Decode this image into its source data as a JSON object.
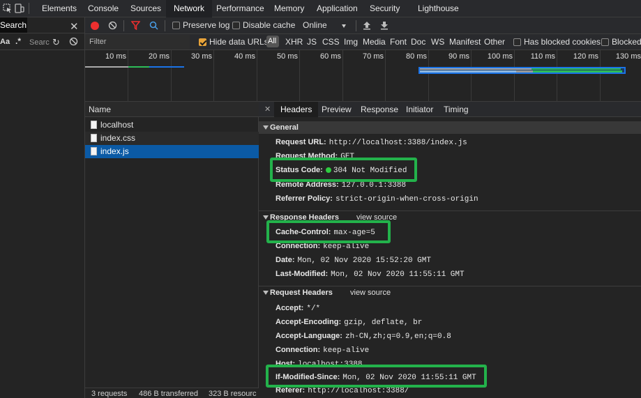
{
  "tabs": [
    "Elements",
    "Console",
    "Sources",
    "Network",
    "Performance",
    "Memory",
    "Application",
    "Security",
    "Lighthouse"
  ],
  "active_tab": "Network",
  "left": {
    "search_tab": "Search",
    "case_label": "Aa",
    "regex_label": ".*",
    "search_placeholder": "Searc"
  },
  "toolbar": {
    "preserve_log": "Preserve log",
    "disable_cache": "Disable cache",
    "throttle": "Online"
  },
  "filterbar": {
    "filter_placeholder": "Filter",
    "hide_data_urls": "Hide data URLs",
    "types": [
      "All",
      "XHR",
      "JS",
      "CSS",
      "Img",
      "Media",
      "Font",
      "Doc",
      "WS",
      "Manifest",
      "Other"
    ],
    "blocked_cookies": "Has blocked cookies",
    "blocked": "Blocked"
  },
  "timeline": {
    "ticks": [
      "10 ms",
      "20 ms",
      "30 ms",
      "40 ms",
      "50 ms",
      "60 ms",
      "70 ms",
      "80 ms",
      "90 ms",
      "100 ms",
      "110 ms",
      "120 ms",
      "130 ms"
    ]
  },
  "list": {
    "header": "Name",
    "rows": [
      "localhost",
      "index.css",
      "index.js"
    ],
    "selected": "index.js",
    "status": {
      "requests": "3 requests",
      "transferred": "486 B transferred",
      "resources": "323 B resourc"
    }
  },
  "detail": {
    "tabs": [
      "Headers",
      "Preview",
      "Response",
      "Initiator",
      "Timing"
    ],
    "active_tab": "Headers",
    "general": {
      "title": "General",
      "rows": [
        {
          "k": "Request URL:",
          "v": "http://localhost:3388/index.js"
        },
        {
          "k": "Request Method:",
          "v": "GET"
        },
        {
          "k": "Status Code:",
          "v": "304 Not Modified"
        },
        {
          "k": "Remote Address:",
          "v": "127.0.0.1:3388"
        },
        {
          "k": "Referrer Policy:",
          "v": "strict-origin-when-cross-origin"
        }
      ]
    },
    "response_headers": {
      "title": "Response Headers",
      "view_source": "view source",
      "rows": [
        {
          "k": "Cache-Control:",
          "v": "max-age=5"
        },
        {
          "k": "Connection:",
          "v": "keep-alive"
        },
        {
          "k": "Date:",
          "v": "Mon, 02 Nov 2020 15:52:20 GMT"
        },
        {
          "k": "Last-Modified:",
          "v": "Mon, 02 Nov 2020 11:55:11 GMT"
        }
      ]
    },
    "request_headers": {
      "title": "Request Headers",
      "view_source": "view source",
      "rows": [
        {
          "k": "Accept:",
          "v": "*/*"
        },
        {
          "k": "Accept-Encoding:",
          "v": "gzip, deflate, br"
        },
        {
          "k": "Accept-Language:",
          "v": "zh-CN,zh;q=0.9,en;q=0.8"
        },
        {
          "k": "Connection:",
          "v": "keep-alive"
        },
        {
          "k": "Host:",
          "v": "localhost:3388"
        },
        {
          "k": "If-Modified-Since:",
          "v": "Mon, 02 Nov 2020 11:55:11 GMT"
        },
        {
          "k": "Referer:",
          "v": "http://localhost:3388/"
        }
      ]
    }
  },
  "colors": {
    "highlight_green": "#23b24b",
    "record_red": "#ed2f2f",
    "selected_row": "#0b5aa5",
    "status_dot": "#2ecc40"
  }
}
